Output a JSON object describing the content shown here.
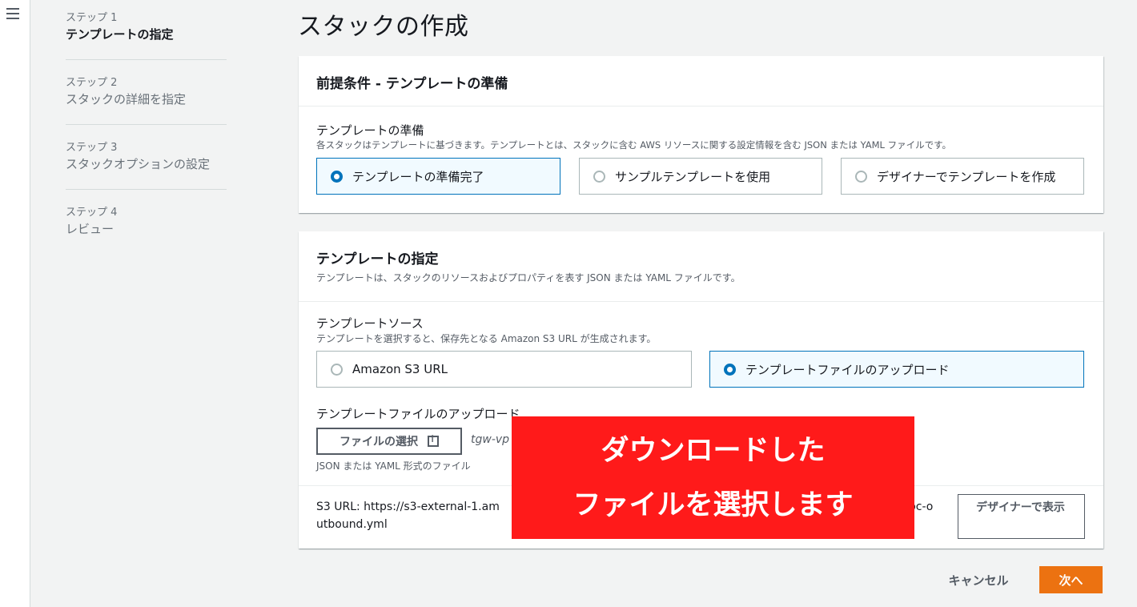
{
  "page_title": "スタックの作成",
  "steps": [
    {
      "num": "ステップ 1",
      "title": "テンプレートの指定"
    },
    {
      "num": "ステップ 2",
      "title": "スタックの詳細を指定"
    },
    {
      "num": "ステップ 3",
      "title": "スタックオプションの設定"
    },
    {
      "num": "ステップ 4",
      "title": "レビュー"
    }
  ],
  "prereq": {
    "heading": "前提条件 - テンプレートの準備",
    "field_label": "テンプレートの準備",
    "field_desc": "各スタックはテンプレートに基づきます。テンプレートとは、スタックに含む AWS リソースに関する設定情報を含む JSON または YAML ファイルです。",
    "options": [
      "テンプレートの準備完了",
      "サンプルテンプレートを使用",
      "デザイナーでテンプレートを作成"
    ],
    "selected": "テンプレートの準備完了"
  },
  "spec": {
    "heading": "テンプレートの指定",
    "heading_desc": "テンプレートは、スタックのリソースおよびプロパティを表す JSON または YAML ファイルです。",
    "source_label": "テンプレートソース",
    "source_desc": "テンプレートを選択すると、保存先となる Amazon S3 URL が生成されます。",
    "source_options": [
      "Amazon S3 URL",
      "テンプレートファイルのアップロード"
    ],
    "selected": "テンプレートファイルのアップロード",
    "upload_label": "テンプレートファイルのアップロード",
    "choose_file_button": "ファイルの選択",
    "file_name": "tgw-vp",
    "file_hint": "JSON または YAML 形式のファイル",
    "s3_url_line1_start": "S3 URL:  https://s3-external-1.am",
    "s3_url_line1_end": "v-vpc-o",
    "s3_url_line2": "utbound.yml",
    "designer_button": "デザイナーで表示"
  },
  "overlay": {
    "line1": "ダウンロードした",
    "line2": "ファイルを選択します",
    "color": "#ff1a1a"
  },
  "footer": {
    "cancel": "キャンセル",
    "next": "次へ"
  },
  "colors": {
    "accent": "#0073bb",
    "primary_button": "#ec7211"
  }
}
